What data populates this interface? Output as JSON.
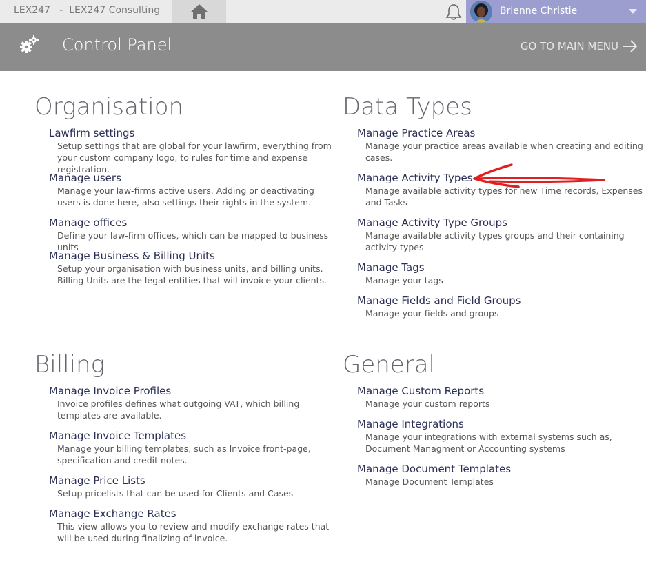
{
  "topbar": {
    "company": "LEX247   -  LEX247 Consulting",
    "home_icon": "home-icon",
    "bell_icon": "bell-icon",
    "user_name": "Brienne Christie",
    "caret_icon": "caret-down-icon"
  },
  "header": {
    "icon": "gears-icon",
    "title": "Control Panel",
    "main_menu_label": "GO TO MAIN MENU",
    "main_menu_icon": "arrow-right-icon"
  },
  "sections": {
    "organisation": {
      "title": "Organisation",
      "items": [
        {
          "title": "Lawfirm settings",
          "desc": "Setup settings that are global for your lawfirm, everything from your custom company logo, to rules for time and expense registration."
        },
        {
          "title": "Manage users",
          "desc": "Manage your law-firms active users. Adding or deactivating users is done here, also settings their rights in the system."
        },
        {
          "title": "Manage offices",
          "desc": "Define your law-firm offices, which can be mapped to business units"
        },
        {
          "title": "Manage Business & Billing Units",
          "desc": "Setup your organisation with business units, and billing units. Billing Units are the legal entities that will invoice your clients."
        }
      ]
    },
    "data_types": {
      "title": "Data Types",
      "items": [
        {
          "title": "Manage Practice Areas",
          "desc": "Manage your practice areas available when creating and editing cases."
        },
        {
          "title": "Manage Activity Types",
          "desc": "Manage available activity types for new Time records, Expenses and Tasks"
        },
        {
          "title": "Manage Activity Type Groups",
          "desc": "Manage available activity types groups and their containing activity types"
        },
        {
          "title": "Manage Tags",
          "desc": "Manage your tags"
        },
        {
          "title": "Manage Fields and Field Groups",
          "desc": "Manage your fields and groups"
        }
      ]
    },
    "billing": {
      "title": "Billing",
      "items": [
        {
          "title": "Manage Invoice Profiles",
          "desc": "Invoice profiles defines what outgoing VAT, which billing templates are available."
        },
        {
          "title": "Manage Invoice Templates",
          "desc": "Manage your billing templates, such as Invoice front-page, specification and credit notes."
        },
        {
          "title": "Manage Price Lists",
          "desc": "Setup pricelists that can be used for Clients and Cases"
        },
        {
          "title": "Manage Exchange Rates",
          "desc": "This view allows you to review and modify exchange rates that will be used during finalizing of invoice."
        }
      ]
    },
    "general": {
      "title": "General",
      "items": [
        {
          "title": "Manage Custom Reports",
          "desc": "Manage your custom reports"
        },
        {
          "title": "Manage Integrations",
          "desc": "Manage your integrations with external systems such as, Document Managment or Accounting systems"
        },
        {
          "title": "Manage Document Templates",
          "desc": "Manage Document Templates"
        }
      ]
    }
  },
  "colors": {
    "header_bg": "#8c8c8c",
    "user_bg": "#9b9ecf",
    "link": "#2b2f55",
    "annotation": "#e02020"
  }
}
